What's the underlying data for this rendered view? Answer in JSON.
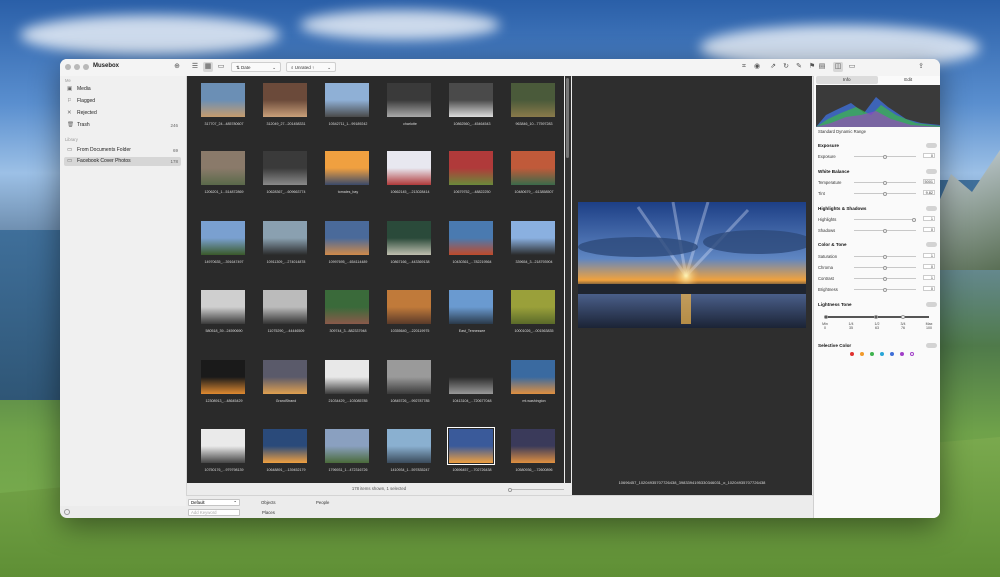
{
  "window": {
    "title": "Musebox"
  },
  "toolbar": {
    "sort_label": "Date",
    "filter_label": "Unrated ↑"
  },
  "sidebar": {
    "section_me": "Me",
    "items": [
      {
        "label": "Media",
        "icon": "photo-icon",
        "count": ""
      },
      {
        "label": "Flagged",
        "icon": "flag-icon",
        "count": ""
      },
      {
        "label": "Rejected",
        "icon": "x-icon",
        "count": ""
      },
      {
        "label": "Trash",
        "icon": "trash-icon",
        "count": "246"
      }
    ],
    "section_library": "Library",
    "library": [
      {
        "label": "From Documents Folder",
        "icon": "folder-icon",
        "count": "69"
      },
      {
        "label": "Facebook Cover Photos",
        "icon": "folder-icon",
        "count": "178"
      }
    ]
  },
  "grid": {
    "thumbs": [
      {
        "cap": "317707_24...485780607"
      },
      {
        "cap": "312049_27...201458331"
      },
      {
        "cap": "10542711_1...99189242"
      },
      {
        "cap": "charlotte"
      },
      {
        "cap": "10862560_...45464543"
      },
      {
        "cap": "963846_10...77597283"
      },
      {
        "cap": "1206201_1...514872869"
      },
      {
        "cap": "10628367_...609663774"
      },
      {
        "cap": "tomales_bay"
      },
      {
        "cap": "10662145_...213028414"
      },
      {
        "cap": "10679752_...48822250"
      },
      {
        "cap": "10480679_...613858507"
      },
      {
        "cap": "14970635_...391647497"
      },
      {
        "cap": "10911309_...274014878"
      },
      {
        "cap": "10997695_...654114489"
      },
      {
        "cap": "10867166_...443369138"
      },
      {
        "cap": "10430361_...782219564"
      },
      {
        "cap": "339654_3...218793904"
      },
      {
        "cap": "580518_39...24590690"
      },
      {
        "cap": "11075290_...44446509"
      },
      {
        "cap": "309744_3...882337948"
      },
      {
        "cap": "10355640_...220119975"
      },
      {
        "cap": "East_Tennessee"
      },
      {
        "cap": "10001026_...001563835"
      },
      {
        "cap": "12308913_...48645429"
      },
      {
        "cap": "GrandStrand"
      },
      {
        "cap": "21034429_...103085785"
      },
      {
        "cap": "10845726_...992787785"
      },
      {
        "cap": "10413104_...720677048"
      },
      {
        "cap": "mt.washington"
      },
      {
        "cap": "10750176_...979798139"
      },
      {
        "cap": "10648891_...139452179"
      },
      {
        "cap": "1796931_1...472316726"
      },
      {
        "cap": "1410934_1...597835247"
      },
      {
        "cap": "10696457_...702726438"
      },
      {
        "cap": "10580936_...72600896"
      }
    ],
    "selected_index": 34
  },
  "status": {
    "text": "178 items shown, 1 selected"
  },
  "preview": {
    "caption": "10696457_10204935707726438_3983394195330346031_o_10204935707726438"
  },
  "inspector": {
    "tab_info": "Info",
    "tab_edit": "Edit",
    "histogram_label": "Standard Dynamic Range",
    "exposure": {
      "title": "Exposure",
      "exposure_label": "Exposure",
      "exposure_val": "0"
    },
    "white_balance": {
      "title": "White Balance",
      "temp_label": "Temperature",
      "temp_val": "5001",
      "tint_label": "Tint",
      "tint_val": "9.82"
    },
    "hs": {
      "title": "Highlights & Shadows",
      "hi_label": "Highlights",
      "hi_val": "1",
      "sh_label": "Shadows",
      "sh_val": "0"
    },
    "ct": {
      "title": "Color & Tone",
      "sat_label": "Saturation",
      "sat_val": "1",
      "chr_label": "Chroma",
      "chr_val": "0",
      "con_label": "Contrast",
      "con_val": "1",
      "bri_label": "Brightness",
      "bri_val": "0"
    },
    "lt": {
      "title": "Lightness Tone",
      "marks": [
        {
          "l": "Min",
          "v": "0"
        },
        {
          "l": "1/4",
          "v": "35"
        },
        {
          "l": "1/2",
          "v": "63"
        },
        {
          "l": "3/4",
          "v": "76"
        },
        {
          "l": "Max",
          "v": "100"
        }
      ]
    },
    "sel_color": {
      "title": "Selective Color",
      "colors": [
        "#e0322f",
        "#f19a2c",
        "#3fb34f",
        "#2aa6d8",
        "#3f6fd8",
        "#a23fc8"
      ]
    }
  },
  "bottombar": {
    "mode_value": "Default",
    "keyword_placeholder": "Add Keyword",
    "objects_label": "Objects",
    "people_label": "People",
    "places_label": "Places"
  }
}
